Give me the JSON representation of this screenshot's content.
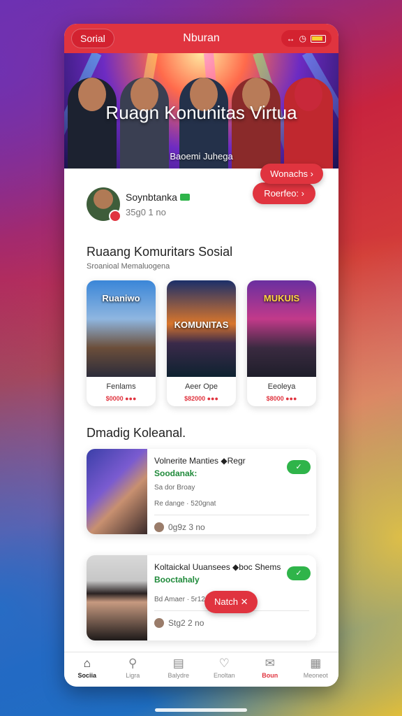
{
  "status": {
    "left_pill": "Sorial",
    "title": "Nburan",
    "icon_names": [
      "arrows-icon",
      "clock-icon",
      "battery-icon"
    ],
    "arrows": "↔",
    "clock": "◷"
  },
  "hero": {
    "title": "Ruagn Konunitas Virtua",
    "subtitle": "Baoemi Juhega",
    "button": "Wonachs ›"
  },
  "user": {
    "name": "Soynbtanka",
    "meta": "35g0  1 no",
    "follow_button": "Roerfeo: ›"
  },
  "section": {
    "title": "Ruaang Komuritars Sosial",
    "subtitle": "Sroanioal Memaluogena"
  },
  "cards": [
    {
      "title_art": "Ruaniwo",
      "label": "Fenlams",
      "price": "$0000 ●●●"
    },
    {
      "title_art": "KOMUNITAS",
      "label": "Aeer Ope",
      "price": "$82000 ●●●"
    },
    {
      "title_art": "MUKUIS",
      "label": "Eeoleya",
      "price": "$8000 ●●●"
    }
  ],
  "list": {
    "title": "Dmadig Koleanal.",
    "items": [
      {
        "title": "Volnerite Manties ◆Regr",
        "subtitle": "Soodanak:",
        "meta1": "Sa dor Broay",
        "meta2": "Re dange · 520gnat",
        "foot": "0g9z  3 no",
        "check": "✓"
      },
      {
        "title": "Koltaickal Uuansees ◆boc Shems",
        "subtitle": "Booctahaly",
        "meta1": "Bd Amaer · 5r120ne",
        "meta2": "",
        "foot": "Stg2  2 no",
        "check": "✓"
      }
    ]
  },
  "match_button": "Natch ✕",
  "tabs": [
    {
      "label": "Sociia",
      "icon": "⌂",
      "icon_name": "home-icon"
    },
    {
      "label": "Ligra",
      "icon": "⚲",
      "icon_name": "search-icon"
    },
    {
      "label": "Balydre",
      "icon": "▤",
      "icon_name": "box-icon"
    },
    {
      "label": "Enoltan",
      "icon": "♡",
      "icon_name": "heart-icon"
    },
    {
      "label": "Boun",
      "icon": "✉",
      "icon_name": "message-icon"
    },
    {
      "label": "Meoneot",
      "icon": "▦",
      "icon_name": "list-icon"
    }
  ],
  "colors": {
    "accent": "#e0343f",
    "success": "#2fb44a"
  }
}
